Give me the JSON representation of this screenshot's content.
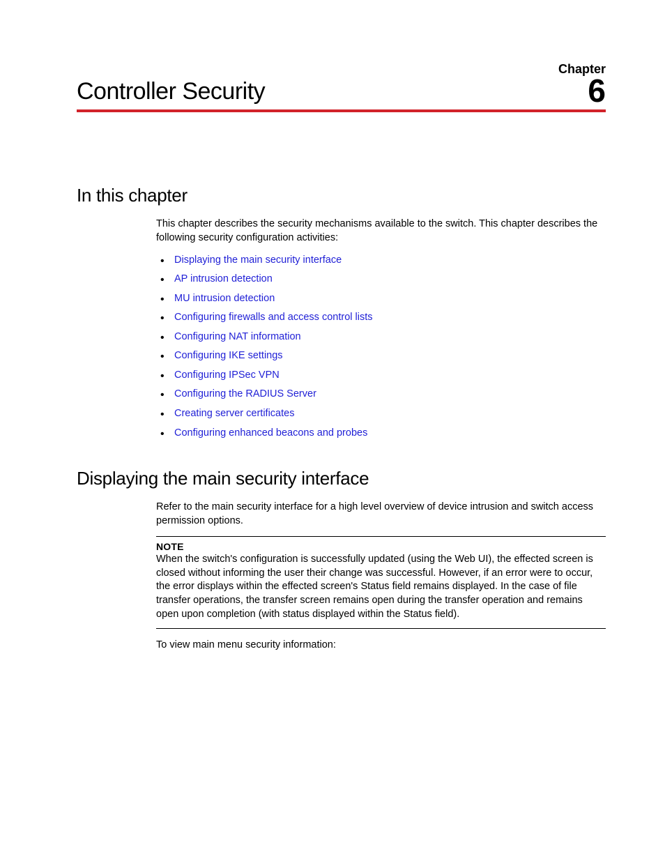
{
  "header": {
    "chapter_label": "Chapter",
    "chapter_number": "6",
    "title": "Controller Security"
  },
  "section1": {
    "heading": "In this chapter",
    "intro": "This chapter describes the security mechanisms available to the switch. This chapter describes the following security configuration activities:",
    "links": [
      "Displaying the main security interface",
      "AP intrusion detection",
      "MU intrusion detection",
      "Configuring firewalls and access control lists",
      "Configuring NAT information",
      "Configuring IKE settings",
      "Configuring IPSec VPN",
      "Configuring the RADIUS Server",
      "Creating server certificates",
      "Configuring enhanced beacons and probes"
    ]
  },
  "section2": {
    "heading": "Displaying the main security interface",
    "intro": "Refer to the main security interface for a high level overview of device intrusion and switch access permission options.",
    "note_label": "NOTE",
    "note_text": "When the switch's configuration is successfully updated (using the Web UI), the effected screen is closed without informing the user their change was successful. However, if an error were to occur, the error displays within the effected screen's Status field remains displayed. In the case of file transfer operations, the transfer screen remains open during the transfer operation and remains open upon completion (with status displayed within the Status field).",
    "followup": "To view main menu security information:"
  }
}
